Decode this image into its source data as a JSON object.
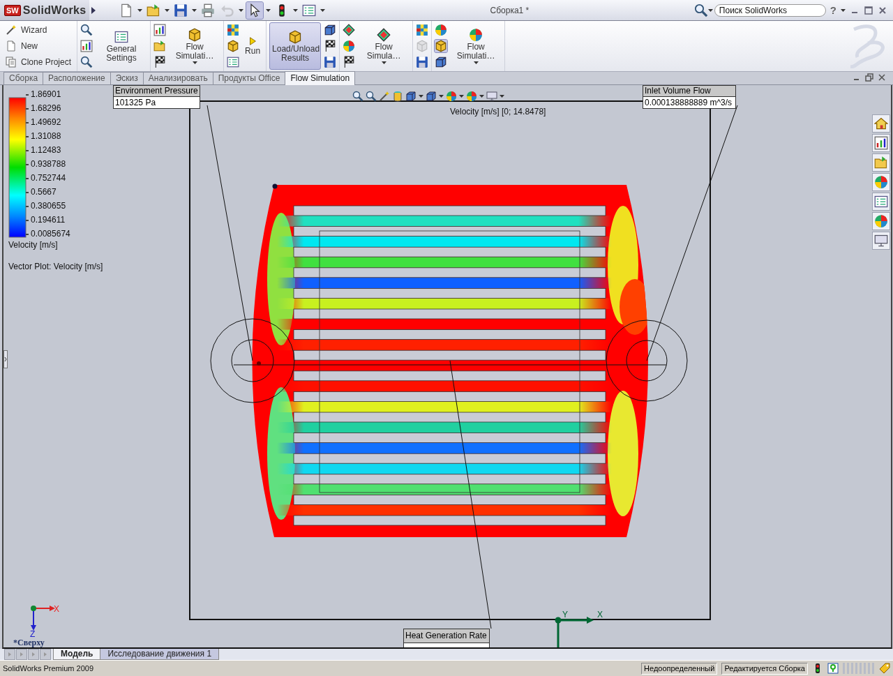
{
  "title_bar": {
    "logo_badge": "SW",
    "logo": "SolidWorks",
    "quick_access": [
      {
        "disabled": false,
        "pressed": false
      },
      {
        "disabled": false,
        "pressed": false
      },
      {
        "disabled": false,
        "pressed": false
      },
      {
        "disabled": false,
        "pressed": false
      },
      {
        "disabled": true,
        "pressed": false
      },
      {
        "disabled": false,
        "pressed": true
      },
      {
        "disabled": false,
        "pressed": false
      },
      {
        "disabled": false,
        "pressed": false
      }
    ],
    "document_title": "Сборка1 *",
    "search": {
      "placeholder": "Поиск SolidWorks"
    },
    "help": "?"
  },
  "ribbon": {
    "groups": [
      {
        "items": [
          {
            "kind": "small",
            "label": "Wizard"
          },
          {
            "kind": "small",
            "label": "New"
          },
          {
            "kind": "small",
            "label": "Clone Project"
          }
        ]
      },
      {
        "items": [
          {
            "kind": "stack",
            "icons": [
              {
                "disabled": false,
                "pressed": false
              },
              {
                "disabled": false,
                "pressed": false
              },
              {
                "disabled": false,
                "pressed": false
              }
            ]
          },
          {
            "kind": "big",
            "label": "General Settings",
            "selected": false,
            "menu": false
          }
        ]
      },
      {
        "items": [
          {
            "kind": "stack",
            "icons": [
              {
                "disabled": false,
                "pressed": false
              },
              {
                "disabled": false,
                "pressed": false
              },
              {
                "disabled": false,
                "pressed": false
              }
            ]
          },
          {
            "kind": "big",
            "label": "Flow Simulati…",
            "selected": false,
            "menu": true
          }
        ]
      },
      {
        "items": [
          {
            "kind": "stack",
            "icons": [
              {
                "disabled": false,
                "pressed": false
              },
              {
                "disabled": false,
                "pressed": false
              },
              {
                "disabled": false,
                "pressed": false
              }
            ]
          },
          {
            "kind": "big",
            "label": "Run",
            "selected": false,
            "menu": false
          }
        ]
      },
      {
        "items": [
          {
            "kind": "big",
            "label": "Load/Unload Results",
            "selected": true,
            "menu": false
          },
          {
            "kind": "stack",
            "icons": [
              {
                "disabled": false,
                "pressed": false
              },
              {
                "disabled": false,
                "pressed": false
              },
              {
                "disabled": false,
                "pressed": false
              }
            ]
          }
        ]
      },
      {
        "items": [
          {
            "kind": "stack",
            "icons": [
              {
                "disabled": false,
                "pressed": false
              },
              {
                "disabled": false,
                "pressed": false
              },
              {
                "disabled": false,
                "pressed": false
              }
            ]
          },
          {
            "kind": "big",
            "label": "Flow Simula…",
            "selected": false,
            "menu": true
          }
        ]
      },
      {
        "items": [
          {
            "kind": "stack",
            "icons": [
              {
                "disabled": false,
                "pressed": false
              },
              {
                "disabled": true,
                "pressed": false
              },
              {
                "disabled": false,
                "pressed": false
              }
            ]
          }
        ]
      },
      {
        "items": [
          {
            "kind": "stack",
            "icons": [
              {
                "disabled": false,
                "pressed": false
              },
              {
                "disabled": false,
                "pressed": true
              },
              {
                "disabled": false,
                "pressed": false
              }
            ]
          },
          {
            "kind": "big",
            "label": "Flow Simulati…",
            "selected": false,
            "menu": true
          }
        ]
      }
    ]
  },
  "tabs": [
    {
      "label": "Сборка",
      "selected": false
    },
    {
      "label": "Расположение",
      "selected": false
    },
    {
      "label": "Эскиз",
      "selected": false
    },
    {
      "label": "Анализировать",
      "selected": false
    },
    {
      "label": "Продукты Office",
      "selected": false
    },
    {
      "label": "Flow Simulation",
      "selected": true
    }
  ],
  "viewport": {
    "legend": {
      "values": [
        "1.86901",
        "1.68296",
        "1.49692",
        "1.31088",
        "1.12483",
        "0.938788",
        "0.752744",
        "0.5667",
        "0.380655",
        "0.194611",
        "0.0085674"
      ],
      "title": "Velocity [m/s]",
      "subtitle": "Vector Plot: Velocity [m/s]"
    },
    "range_label": "Velocity [m/s] [0; 14.8478]",
    "callouts": [
      {
        "title": "Environment Pressure",
        "value": "101325 Pa"
      },
      {
        "title": "Inlet Volume Flow",
        "value": "0.000138888889 m^3/s"
      },
      {
        "title": "Heat Generation Rate"
      }
    ],
    "view_name": "*Сверху",
    "triad": {
      "x": "X",
      "z": "Z"
    },
    "origin": {
      "y": "Y",
      "x": "X"
    }
  },
  "bottom_tabs": [
    {
      "label": "Модель",
      "selected": true
    },
    {
      "label": "Исследование движения 1",
      "selected": false
    }
  ],
  "status_bar": {
    "product": "SolidWorks Premium 2009",
    "fields": [
      "Недоопределенный",
      "Редактируется Сборка"
    ]
  }
}
